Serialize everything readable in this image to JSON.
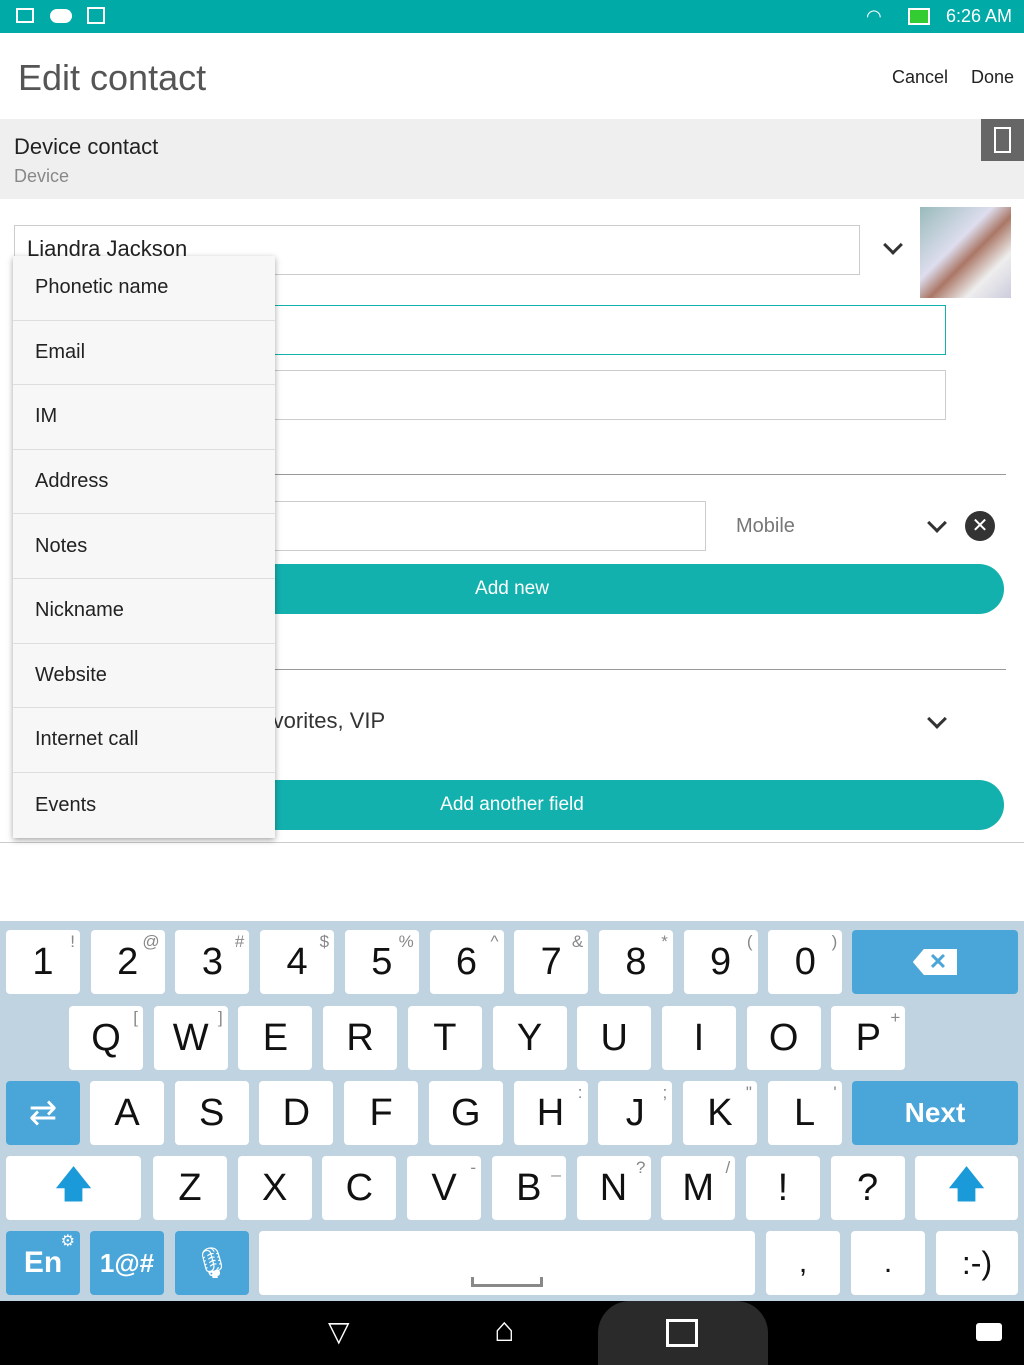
{
  "status_bar": {
    "time": "6:26 AM",
    "icons": [
      "gallery-icon",
      "cloud-upload-icon",
      "mail-icon",
      "wifi-icon",
      "battery-charging-icon"
    ],
    "color": "#00aaa7"
  },
  "app_bar": {
    "title": "Edit contact",
    "cancel": "Cancel",
    "done": "Done"
  },
  "account": {
    "title": "Device contact",
    "subtitle": "Device",
    "icon": "phone-device-icon"
  },
  "form": {
    "name_value": "Liandra Jackson",
    "phone_type": "Mobile",
    "add_new": "Add new",
    "groups_value": "Favorites, VIP",
    "groups_visible": "vorites, VIP",
    "add_another_field": "Add another field"
  },
  "dropdown_menu": {
    "items": [
      "Phonetic name",
      "Email",
      "IM",
      "Address",
      "Notes",
      "Nickname",
      "Website",
      "Internet call",
      "Events"
    ]
  },
  "keyboard": {
    "accent": "#4aa6d8",
    "rows": [
      [
        [
          "1",
          "!"
        ],
        [
          "2",
          "@"
        ],
        [
          "3",
          "#"
        ],
        [
          "4",
          "$"
        ],
        [
          "5",
          "%"
        ],
        [
          "6",
          "^"
        ],
        [
          "7",
          "&"
        ],
        [
          "8",
          "*"
        ],
        [
          "9",
          "("
        ],
        [
          "0",
          ")"
        ]
      ],
      [
        [
          "Q",
          "["
        ],
        [
          "W",
          "]"
        ],
        [
          "E",
          ""
        ],
        [
          "R",
          ""
        ],
        [
          "T",
          ""
        ],
        [
          "Y",
          ""
        ],
        [
          "U",
          ""
        ],
        [
          "I",
          ""
        ],
        [
          "O",
          ""
        ],
        [
          "P",
          "+"
        ]
      ],
      [
        [
          "A",
          ""
        ],
        [
          "S",
          ""
        ],
        [
          "D",
          ""
        ],
        [
          "F",
          ""
        ],
        [
          "G",
          ""
        ],
        [
          "H",
          ":"
        ],
        [
          "J",
          ";"
        ],
        [
          "K",
          "\""
        ],
        [
          "L",
          "'"
        ]
      ],
      [
        [
          "Z",
          ""
        ],
        [
          "X",
          ""
        ],
        [
          "C",
          ""
        ],
        [
          "V",
          "-"
        ],
        [
          "B",
          "_"
        ],
        [
          "N",
          "?"
        ],
        [
          "M",
          "/"
        ],
        [
          "!",
          ""
        ],
        [
          "?",
          ""
        ]
      ]
    ],
    "next": "Next",
    "lang": "En",
    "symbols": "1@#",
    "comma": ",",
    "period": ".",
    "smiley": ":-)"
  }
}
